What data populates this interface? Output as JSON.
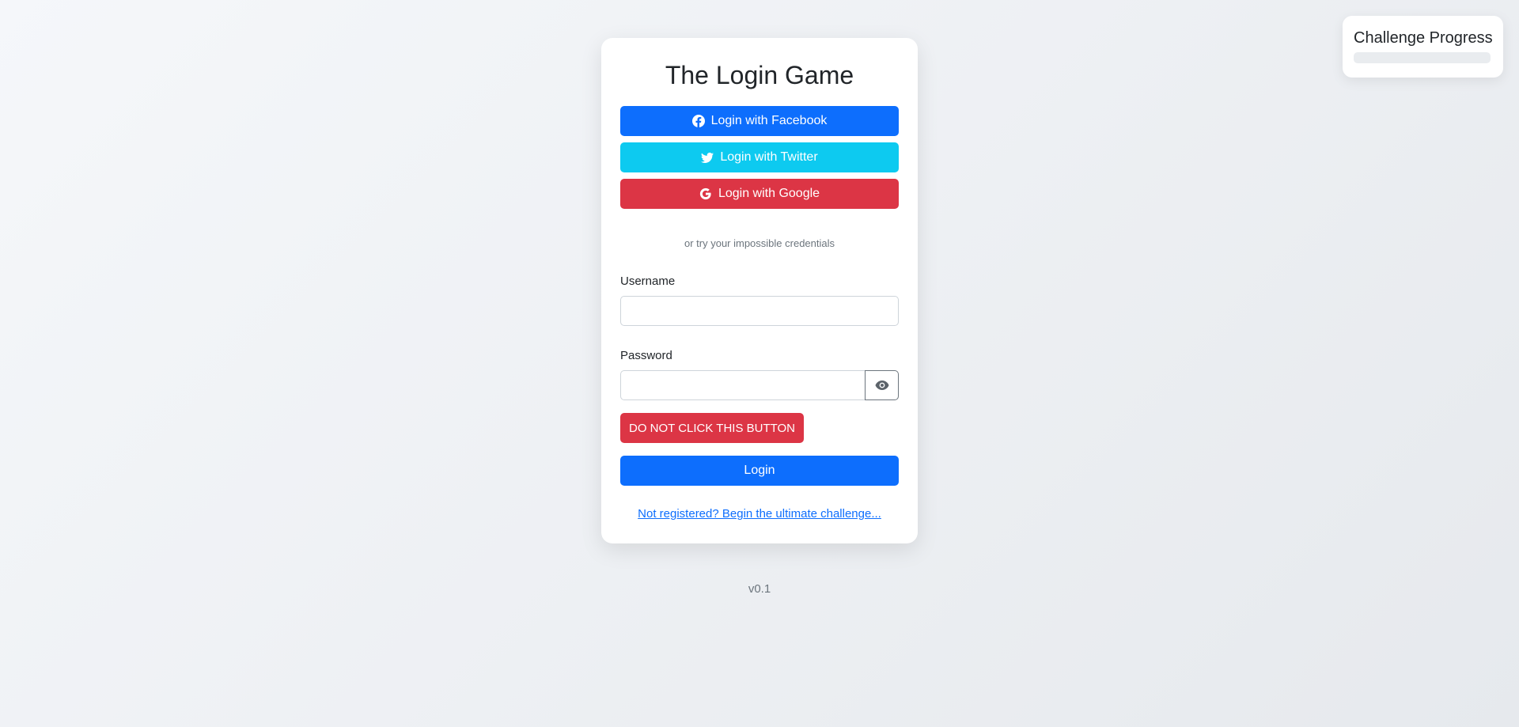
{
  "app": {
    "title": "The Login Game",
    "version": "v0.1"
  },
  "social": {
    "facebook_label": "Login with Facebook",
    "twitter_label": "Login with Twitter",
    "google_label": "Login with Google"
  },
  "divider_text": "or try your impossible credentials",
  "form": {
    "username_label": "Username",
    "username_value": "",
    "password_label": "Password",
    "password_value": "",
    "danger_button_label": "DO NOT CLICK THIS BUTTON",
    "login_button_label": "Login",
    "register_link": "Not registered? Begin the ultimate challenge..."
  },
  "progress": {
    "title": "Challenge Progress",
    "fraction": 0
  },
  "icons": {
    "facebook": "facebook-icon",
    "twitter": "twitter-icon",
    "google": "google-icon",
    "eye": "eye-icon"
  },
  "colors": {
    "primary": "#0d6efd",
    "info": "#0dcaf0",
    "danger": "#dc3545"
  }
}
